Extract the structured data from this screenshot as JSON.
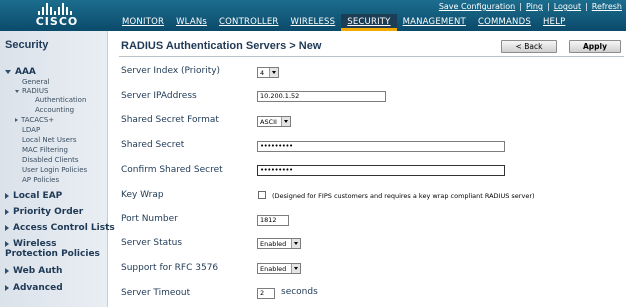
{
  "header": {
    "logo_text": "CISCO",
    "top_links": [
      "Save Configuration",
      "Ping",
      "Logout",
      "Refresh"
    ],
    "tabs": [
      "MONITOR",
      "WLANs",
      "CONTROLLER",
      "WIRELESS",
      "SECURITY",
      "MANAGEMENT",
      "COMMANDS",
      "HELP"
    ],
    "active_tab": "SECURITY",
    "colors": {
      "header_bg": "#0b4a6a",
      "active_tab_underline": "#f2a900"
    }
  },
  "sidebar": {
    "title": "Security",
    "aaa": {
      "label": "AAA",
      "items": [
        "General",
        "RADIUS"
      ],
      "radius_sub": [
        "Authentication",
        "Accounting"
      ],
      "items2": [
        "TACACS+",
        "LDAP",
        "Local Net Users",
        "MAC Filtering",
        "Disabled Clients",
        "User Login Policies",
        "AP Policies"
      ]
    },
    "sections": [
      "Local EAP",
      "Priority Order",
      "Access Control Lists",
      "Wireless Protection Policies",
      "Web Auth",
      "Advanced"
    ]
  },
  "main": {
    "title": "RADIUS Authentication Servers > New",
    "back_label": "< Back",
    "apply_label": "Apply",
    "fields": {
      "server_index_label": "Server Index (Priority)",
      "server_index_value": "4",
      "server_ip_label": "Server IPAddress",
      "server_ip_value": "10.200.1.52",
      "secret_format_label": "Shared Secret Format",
      "secret_format_value": "ASCII",
      "shared_secret_label": "Shared Secret",
      "shared_secret_value": "•••••••••",
      "confirm_secret_label": "Confirm Shared Secret",
      "confirm_secret_value": "•••••••••",
      "key_wrap_label": "Key Wrap",
      "key_wrap_checked": false,
      "key_wrap_note": "(Designed for FIPS customers and requires a key wrap compliant RADIUS server)",
      "port_label": "Port Number",
      "port_value": "1812",
      "status_label": "Server Status",
      "status_value": "Enabled",
      "rfc_label": "Support for RFC 3576",
      "rfc_value": "Enabled",
      "timeout_label": "Server Timeout",
      "timeout_value": "2",
      "timeout_units": "seconds"
    }
  }
}
